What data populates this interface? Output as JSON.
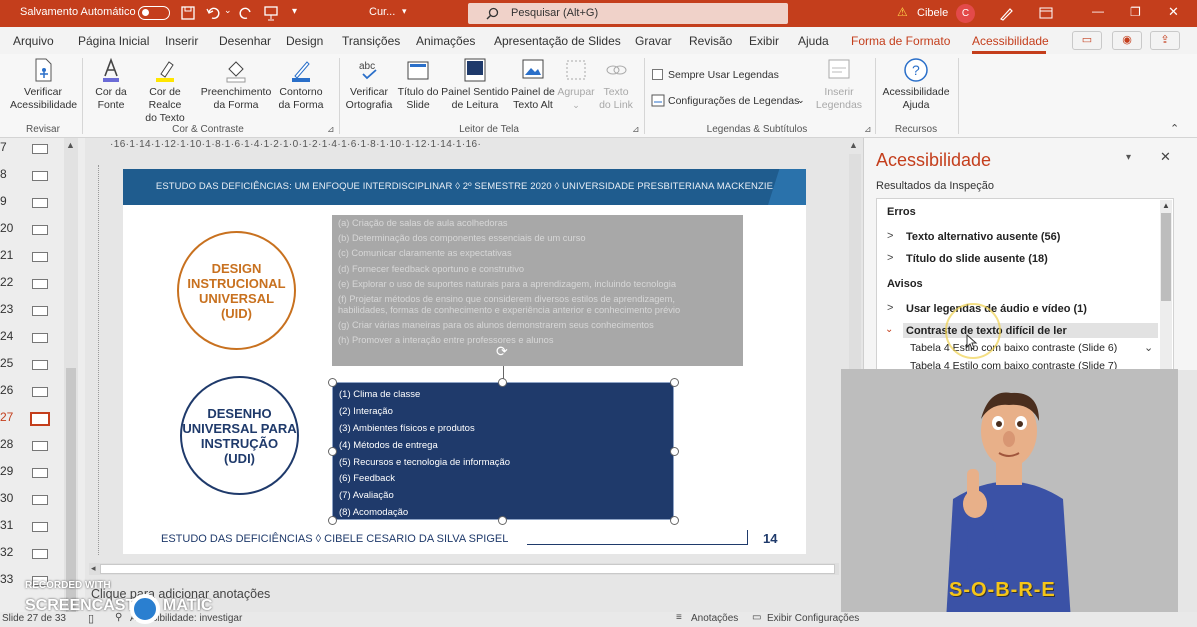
{
  "titlebar": {
    "autosave": "Salvamento Automático",
    "doc_title": "Cur...",
    "search_placeholder": "Pesquisar (Alt+G)",
    "user_name": "Cibele",
    "user_initial": "C",
    "bg_color": "#c43e1c"
  },
  "tabs": [
    "Arquivo",
    "Página Inicial",
    "Inserir",
    "Desenhar",
    "Design",
    "Transições",
    "Animações",
    "Apresentação de Slides",
    "Gravar",
    "Revisão",
    "Exibir",
    "Ajuda",
    "Forma de Formato",
    "Acessibilidade"
  ],
  "ribbon": {
    "buttons": {
      "verificar_acc": "Verificar\nAcessibilidade",
      "cor_fonte": "Cor da\nFonte",
      "cor_realce": "Cor de Realce\ndo Texto",
      "preenchimento": "Preenchimento\nda Forma",
      "contorno": "Contorno\nda Forma",
      "ortografia": "Verificar\nOrtografia",
      "titulo_slide": "Título do\nSlide",
      "painel_sentido": "Painel Sentido\nde Leitura",
      "painel_alt": "Painel de\nTexto Alt",
      "agrupar": "Agrupar",
      "texto_link": "Texto\ndo Link",
      "sempre_legendas": "Sempre Usar Legendas",
      "config_legendas": "Configurações de Legendas",
      "inserir_legendas": "Inserir\nLegendas",
      "acc_ajuda": "Acessibilidade\nAjuda"
    },
    "groups": {
      "revisar": "Revisar",
      "cor_contraste": "Cor & Contraste",
      "leitor": "Leitor de Tela",
      "legendas": "Legendas & Subtítulos",
      "recursos": "Recursos"
    }
  },
  "thumbnails": {
    "numbers": [
      "7",
      "8",
      "9",
      "20",
      "21",
      "22",
      "23",
      "24",
      "25",
      "26",
      "27",
      "28",
      "29",
      "30",
      "31",
      "32",
      "33"
    ],
    "current": "27"
  },
  "ruler_text": "·16·1·14·1·12·1·10·1·8·1·6·1·4·1·2·1·0·1·2·1·4·1·6·1·8·1·10·1·12·1·14·1·16·",
  "slide": {
    "banner": "ESTUDO DAS DEFICIÊNCIAS: UM ENFOQUE INTERDISCIPLINAR ◊  2º SEMESTRE 2020  ◊  UNIVERSIDADE PRESBITERIANA MACKENZIE",
    "circle1": "DESIGN\nINSTRUCIONAL\nUNIVERSAL\n(UID)",
    "circle2": "DESENHO\nUNIVERSAL PARA\nINSTRUÇÃO\n(UDI)",
    "gray_items": [
      "(a) Criação de salas de aula acolhedoras",
      "(b) Determinação dos componentes essenciais de um curso",
      "(c) Comunicar claramente as expectativas",
      "(d) Fornecer feedback oportuno e construtivo",
      "(e) Explorar o uso de suportes naturais para a aprendizagem, incluindo tecnologia",
      "(f) Projetar métodos de ensino que considerem diversos estilos de aprendizagem,",
      "habilidades, formas de conhecimento e experiência anterior e conhecimento prévio",
      "(g) Criar várias maneiras para os alunos demonstrarem seus conhecimentos",
      "(h) Promover a interação entre professores e alunos"
    ],
    "blue_items": [
      "(1) Clima de classe",
      "(2) Interação",
      "(3) Ambientes físicos e produtos",
      "(4) Métodos de entrega",
      "(5) Recursos e tecnologia de informação",
      "(6) Feedback",
      "(7) Avaliação",
      "(8) Acomodação"
    ],
    "footer": "ESTUDO DAS DEFICIÊNCIAS ◊  CIBELE CESARIO DA SILVA SPIGEL",
    "page_num": "14",
    "orange": "#c8711f",
    "navy": "#1f3a6b"
  },
  "notes_placeholder": "Clique para adicionar anotações",
  "acc_panel": {
    "title": "Acessibilidade",
    "subtitle": "Resultados da Inspeção",
    "errors_header": "Erros",
    "errors": [
      "Texto alternativo ausente (56)",
      "Título do slide ausente (18)"
    ],
    "warnings_header": "Avisos",
    "warnings": [
      "Usar legendas de áudio e vídeo (1)",
      "Contraste de texto difícil de ler"
    ],
    "sub_items": [
      "Tabela 4 Estilo com baixo contraste (Slide 6)",
      "Tabela 4 Estilo com baixo contraste (Slide 7)"
    ]
  },
  "avatar_caption": "S-O-B-R-E",
  "watermark": {
    "line1": "RECORDED WITH",
    "line2a": "SCREENCAST",
    "line2b": "MATIC"
  },
  "status": {
    "slide_count": "Slide 27 de 33",
    "acc_status": "Acessibilidade: investigar",
    "notes": "Anotações",
    "display": "Exibir Configurações"
  }
}
